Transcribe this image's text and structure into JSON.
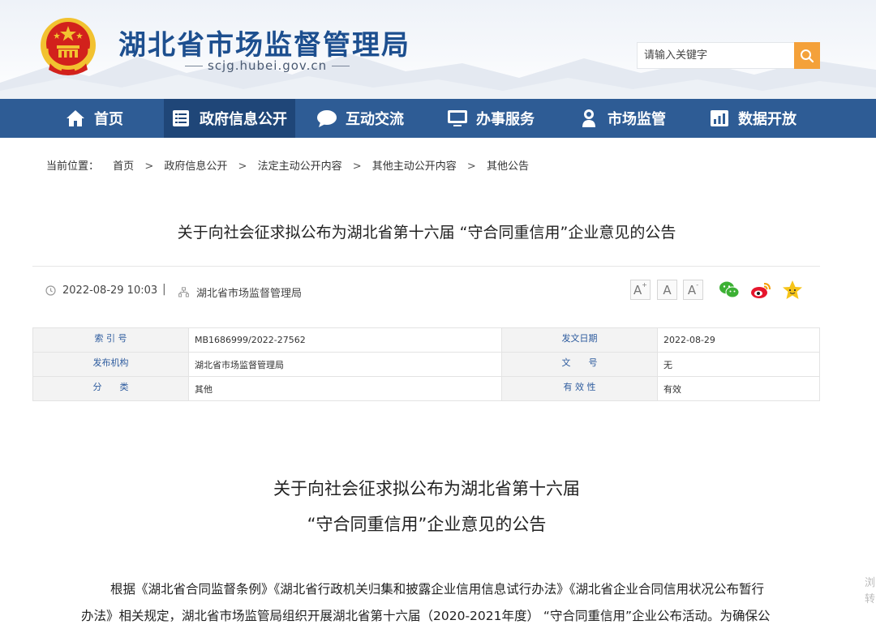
{
  "header": {
    "site_title": "湖北省市场监督管理局",
    "site_url": "scjg.hubei.gov.cn",
    "search_placeholder": "请输入关键字"
  },
  "nav": {
    "items": [
      {
        "label": "首页",
        "icon": "home-icon"
      },
      {
        "label": "政府信息公开",
        "icon": "document-list-icon",
        "active": true
      },
      {
        "label": "互动交流",
        "icon": "chat-bubble-icon"
      },
      {
        "label": "办事服务",
        "icon": "monitor-icon"
      },
      {
        "label": "市场监管",
        "icon": "inspector-icon"
      },
      {
        "label": "数据开放",
        "icon": "bar-chart-icon"
      }
    ]
  },
  "breadcrumb": {
    "label": "当前位置：",
    "items": [
      "首页",
      "政府信息公开",
      "法定主动公开内容",
      "其他主动公开内容",
      "其他公告"
    ],
    "separator": ">"
  },
  "article": {
    "title": "关于向社会征求拟公布为湖北省第十六届 “守合同重信用”企业意见的公告",
    "date": "2022-08-29 10:03",
    "divider": "|",
    "publisher": "湖北省市场监督管理局",
    "font_size_buttons": [
      "A+",
      "A",
      "A-"
    ],
    "share_icons": [
      "wechat-icon",
      "weibo-icon",
      "favorite-star-icon"
    ]
  },
  "info_table": {
    "rows": [
      {
        "k1": "索 引 号",
        "v1": "MB1686999/2022-27562",
        "k2": "发文日期",
        "v2": "2022-08-29"
      },
      {
        "k1": "发布机构",
        "v1": "湖北省市场监督管理局",
        "k2": "文　　号",
        "v2": "无"
      },
      {
        "k1": "分　　类",
        "v1": "其他",
        "k2": "有 效 性",
        "v2": "有效"
      }
    ]
  },
  "document": {
    "title_line1": "关于向社会征求拟公布为湖北省第十六届",
    "title_line2": "“守合同重信用”企业意见的公告",
    "para_line1": "根据《湖北省合同监督条例》《湖北省行政机关归集和披露企业信用信息试行办法》《湖北省企业合同信用状况公布暂行",
    "para_line2": "办法》相关规定，湖北省市场监管局组织开展湖北省第十六届（2020-2021年度） “守合同重信用”企业公布活动。为确保公",
    "side_text_1": "浏",
    "side_text_2": "转"
  },
  "colors": {
    "nav_bg": "#2e5c95",
    "nav_active_bg": "#1f4678",
    "title_blue": "#1d4f8f",
    "search_button": "#f4a13a",
    "emblem_red": "#d2211c",
    "emblem_gold": "#f2c230"
  }
}
